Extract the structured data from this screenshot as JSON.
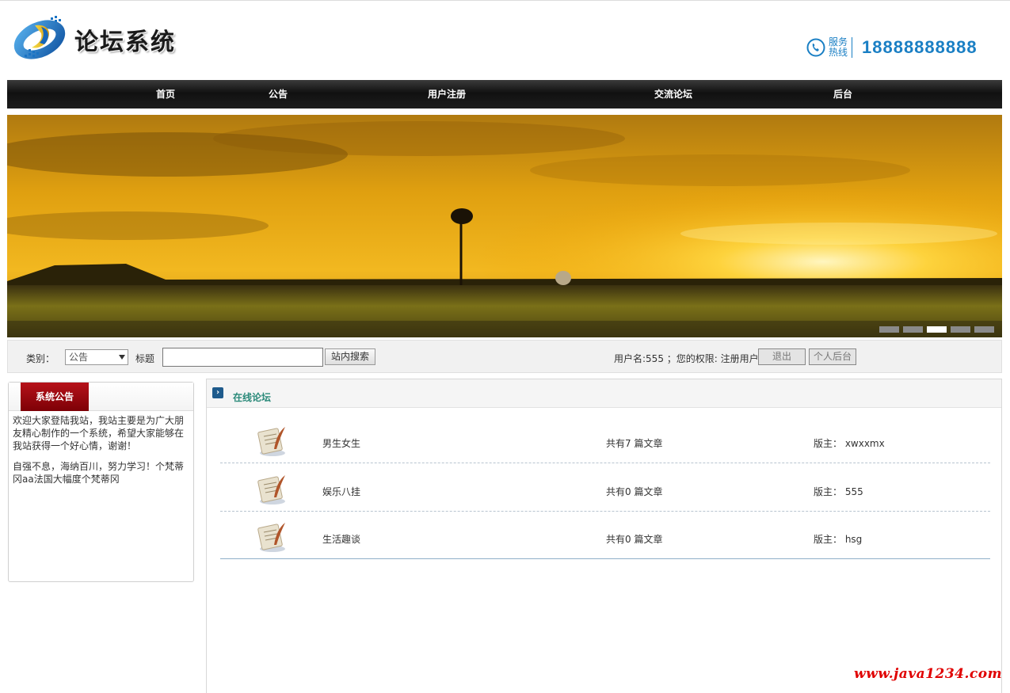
{
  "header": {
    "site_title": "论坛系统",
    "hotline_label": "服务热线",
    "hotline_number": "18888888888"
  },
  "nav": {
    "items": [
      "首页",
      "公告",
      "用户注册",
      "交流论坛",
      "后台"
    ]
  },
  "banner": {
    "slide_count": 5,
    "active_slide": 3
  },
  "search": {
    "category_label": "类别：",
    "category_value": "公告",
    "title_label": "标题",
    "title_value": "",
    "search_button": "站内搜索"
  },
  "user": {
    "info": "用户名:555 ；您的权限: 注册用户",
    "logout_button": "退出",
    "backend_button": "个人后台"
  },
  "notice": {
    "tab_label": "系统公告",
    "paragraphs": [
      "欢迎大家登陆我站，我站主要是为广大朋友精心制作的一个系统，希望大家能够在我站获得一个好心情，谢谢！",
      "自强不息，海纳百川，努力学习！个梵蒂冈aa法国大幅度个梵蒂冈"
    ]
  },
  "forum": {
    "title": "在线论坛",
    "rows": [
      {
        "name": "男生女生",
        "count": "共有7 篇文章",
        "moderator": "版主： xwxxmx"
      },
      {
        "name": "娱乐八挂",
        "count": "共有0 篇文章",
        "moderator": "版主： 555"
      },
      {
        "name": "生活趣谈",
        "count": "共有0 篇文章",
        "moderator": "版主： hsg"
      }
    ]
  },
  "watermark": "www.java1234.com",
  "colors": {
    "accent_blue": "#1a7fc4",
    "notice_red": "#9e0b12",
    "forum_title": "#2b8a7a",
    "watermark_red": "#e00000"
  }
}
